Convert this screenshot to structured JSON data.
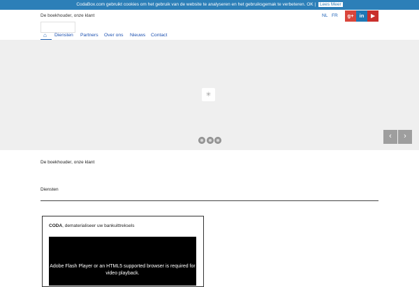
{
  "cookie": {
    "message": "CodaBox.com gebruikt cookies om het gebruik van de website te analyseren en het gebruiksgemak te verbeteren.",
    "ok_label": "OK |",
    "more_label": "Lees Meer"
  },
  "header": {
    "tagline": "De boekhouder, onze klant",
    "languages": [
      "NL",
      "FR"
    ],
    "social": {
      "gplus": "g+",
      "linkedin": "in",
      "youtube": "▶"
    }
  },
  "nav": {
    "items": [
      "Diensten",
      "Partners",
      "Over ons",
      "Nieuws",
      "Contact"
    ]
  },
  "slider": {
    "prev_icon": "‹",
    "next_icon": "›"
  },
  "content": {
    "intro": "De boekhouder, onze klant",
    "services_title": "Diensten",
    "card": {
      "title_bold": "CODA",
      "title_rest": ", dematerialiseer uw bankuittreksels",
      "video_message": "Adobe Flash Player or an HTML5 supported browser is required for video playback."
    }
  }
}
